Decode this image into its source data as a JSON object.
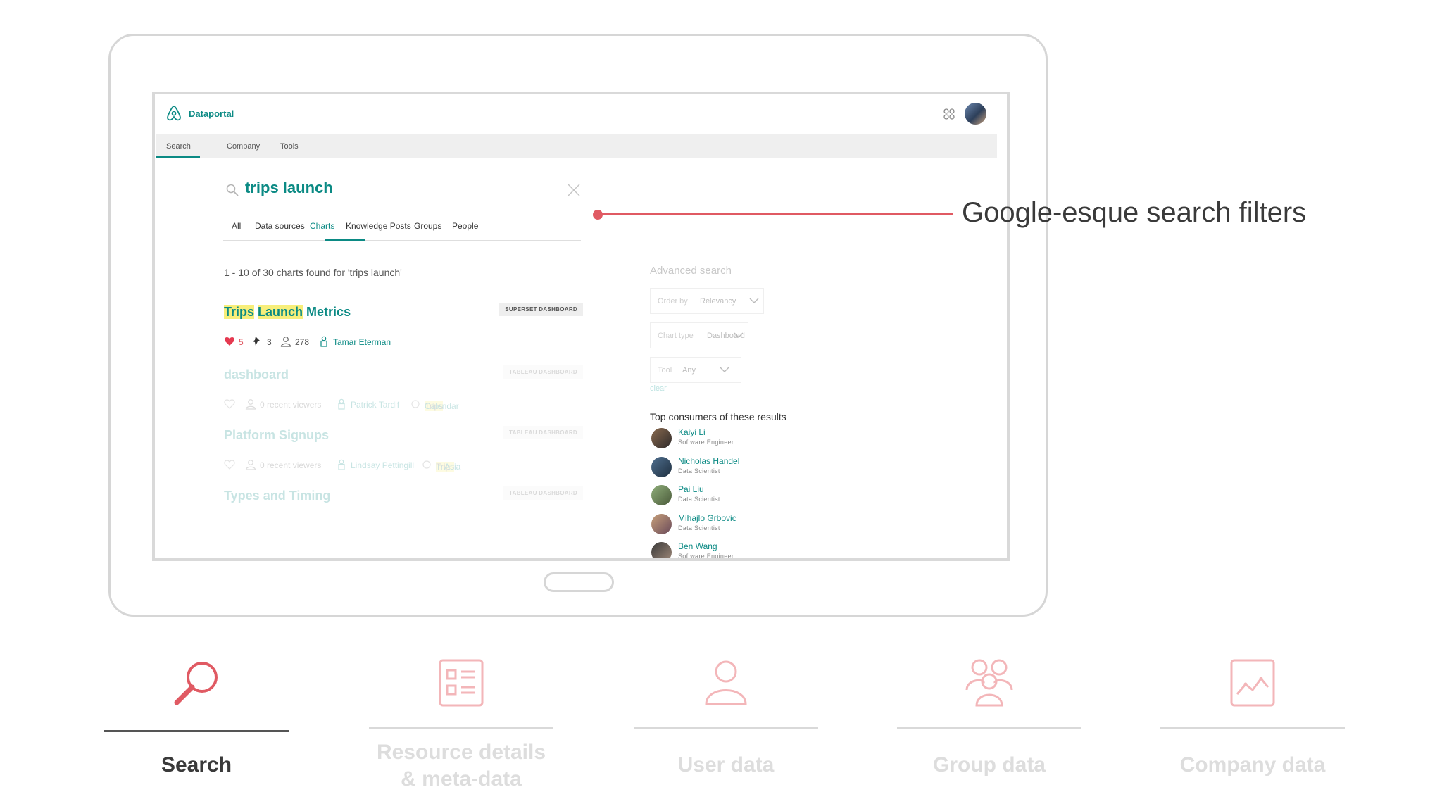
{
  "app": {
    "brand": "Dataportal",
    "nav": [
      "Search",
      "Company",
      "Tools"
    ]
  },
  "search": {
    "query": "trips launch",
    "filters": [
      "All",
      "Data sources",
      "Charts",
      "Knowledge Posts",
      "Groups",
      "People"
    ],
    "active_filter": "Charts",
    "results_count": "1 - 10 of 30 charts found for 'trips launch'"
  },
  "results": [
    {
      "title_parts": [
        "Trips",
        " ",
        "Launch",
        " Metrics"
      ],
      "badge": "SUPERSET DASHBOARD",
      "likes": "5",
      "stars": "3",
      "viewers": "278",
      "owner": "Tamar Eterman"
    },
    {
      "title": "dashboard",
      "badge": "TABLEAU DASHBOARD",
      "viewers": "0 recent viewers",
      "owner": "Patrick Tardif",
      "group_hl": "Trips",
      "group_rest": " Calendar"
    },
    {
      "title": "Platform Signups",
      "badge": "TABLEAU DASHBOARD",
      "viewers": "0 recent viewers",
      "owner": "Lindsay Pettingill",
      "group_hl": "Trips",
      "group_rest": " in Asia"
    },
    {
      "title": "Types and Timing",
      "badge": "TABLEAU DASHBOARD"
    }
  ],
  "advanced": {
    "title": "Advanced search",
    "order_label": "Order by",
    "order_value": "Relevancy",
    "chart_type_label": "Chart type",
    "chart_type_value": "Dashboard",
    "tool_label": "Tool",
    "tool_value": "Any",
    "clear": "clear"
  },
  "consumers": {
    "title": "Top consumers of these results",
    "people": [
      {
        "name": "Kaiyi Li",
        "role": "Software Engineer"
      },
      {
        "name": "Nicholas Handel",
        "role": "Data Scientist"
      },
      {
        "name": "Pai Liu",
        "role": "Data Scientist"
      },
      {
        "name": "Mihajlo Grbovic",
        "role": "Data Scientist"
      },
      {
        "name": "Ben Wang",
        "role": "Software Engineer"
      }
    ]
  },
  "callout": "Google-esque search filters",
  "features": [
    {
      "line1": "Search",
      "line2": ""
    },
    {
      "line1": "Resource details",
      "line2": "& meta-data"
    },
    {
      "line1": "User data",
      "line2": ""
    },
    {
      "line1": "Group data",
      "line2": ""
    },
    {
      "line1": "Company data",
      "line2": ""
    }
  ],
  "colors": {
    "brand_teal": "#0b8a84",
    "accent_red": "#e05a63",
    "highlight": "#f7ee7a",
    "feature_icon_pink": "#f3b6b9"
  }
}
